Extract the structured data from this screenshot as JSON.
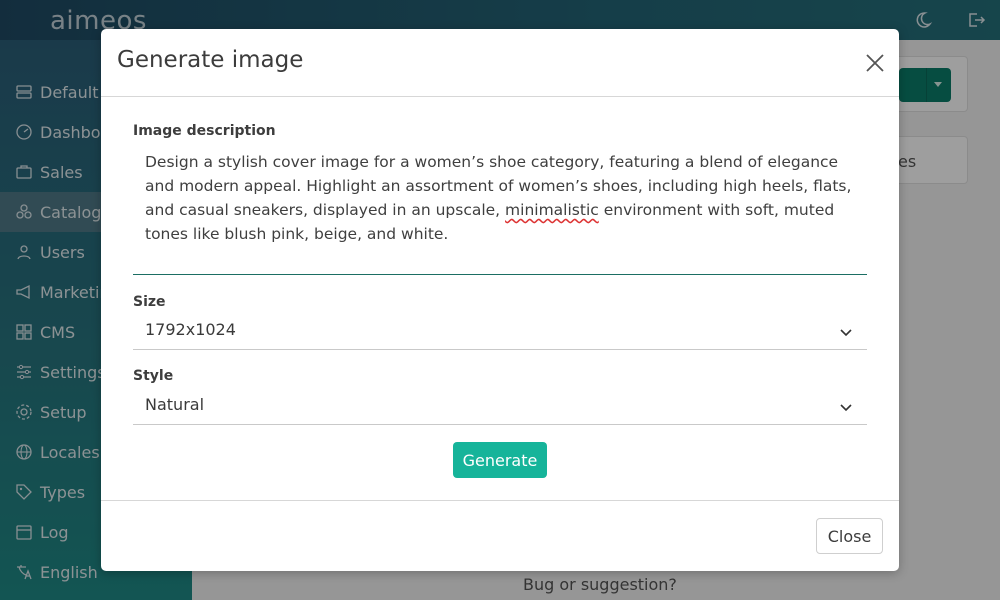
{
  "app": {
    "logo": "aimeos"
  },
  "sidebar": {
    "items": [
      {
        "label": "Default",
        "icon": "server-icon"
      },
      {
        "label": "Dashboard",
        "icon": "dashboard-icon"
      },
      {
        "label": "Sales",
        "icon": "cart-icon"
      },
      {
        "label": "Catalog",
        "icon": "catalog-icon"
      },
      {
        "label": "Users",
        "icon": "user-icon"
      },
      {
        "label": "Marketing",
        "icon": "megaphone-icon"
      },
      {
        "label": "CMS",
        "icon": "grid-icon"
      },
      {
        "label": "Settings",
        "icon": "sliders-icon"
      },
      {
        "label": "Setup",
        "icon": "gear-icon"
      },
      {
        "label": "Locales",
        "icon": "globe-icon"
      },
      {
        "label": "Types",
        "icon": "tag-icon"
      },
      {
        "label": "Log",
        "icon": "calendar-icon"
      },
      {
        "label": "English",
        "icon": "language-icon"
      }
    ],
    "active_index": 3
  },
  "background": {
    "partial_tab": "es",
    "footer_link": "Bug or suggestion?"
  },
  "modal": {
    "title": "Generate image",
    "description_label": "Image description",
    "description_before": "Design a stylish cover image for a women’s shoe category, featuring a blend of elegance and modern appeal. Highlight an assortment of women’s shoes, including high heels, flats, and casual sneakers, displayed in an upscale, ",
    "description_misspelled": "minimalistic",
    "description_after": " environment with soft, muted tones like blush pink, beige, and white.",
    "size_label": "Size",
    "size_value": "1792x1024",
    "style_label": "Style",
    "style_value": "Natural",
    "generate_label": "Generate",
    "close_label": "Close"
  },
  "colors": {
    "accent": "#16b49a",
    "sidebar_active": "#4f7a88",
    "textarea_border": "#1b6e63"
  }
}
